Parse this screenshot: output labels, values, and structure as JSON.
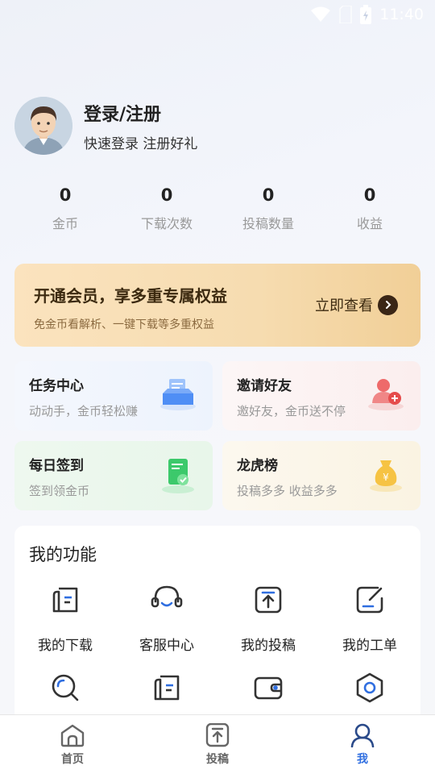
{
  "status_bar": {
    "time": "11:40"
  },
  "profile": {
    "title": "登录/注册",
    "subtitle": "快速登录 注册好礼"
  },
  "stats": [
    {
      "value": "0",
      "label": "金币"
    },
    {
      "value": "0",
      "label": "下载次数"
    },
    {
      "value": "0",
      "label": "投稿数量"
    },
    {
      "value": "0",
      "label": "收益"
    }
  ],
  "vip": {
    "title": "开通会员，享多重专属权益",
    "subtitle": "免金币看解析、一键下载等多重权益",
    "link": "立即查看"
  },
  "cards": {
    "task": {
      "title": "任务中心",
      "subtitle": "动动手，金币轻松赚"
    },
    "invite": {
      "title": "邀请好友",
      "subtitle": "邀好友，金币送不停"
    },
    "sign": {
      "title": "每日签到",
      "subtitle": "签到领金币"
    },
    "rank": {
      "title": "龙虎榜",
      "subtitle": "投稿多多 收益多多"
    }
  },
  "functions": {
    "title": "我的功能",
    "items": [
      {
        "label": "我的下载",
        "icon": "download-doc-icon"
      },
      {
        "label": "客服中心",
        "icon": "headset-icon"
      },
      {
        "label": "我的投稿",
        "icon": "upload-icon"
      },
      {
        "label": "我的工单",
        "icon": "edit-icon"
      },
      {
        "label": "",
        "icon": "search-icon"
      },
      {
        "label": "",
        "icon": "document-icon"
      },
      {
        "label": "",
        "icon": "wallet-icon"
      },
      {
        "label": "",
        "icon": "settings-icon"
      }
    ]
  },
  "tabbar": [
    {
      "label": "首页",
      "icon": "home-icon"
    },
    {
      "label": "投稿",
      "icon": "upload-icon"
    },
    {
      "label": "我",
      "icon": "user-icon",
      "active": true
    }
  ],
  "colors": {
    "accent": "#2f6ee0",
    "vip_gold": "#f6dcb0"
  }
}
